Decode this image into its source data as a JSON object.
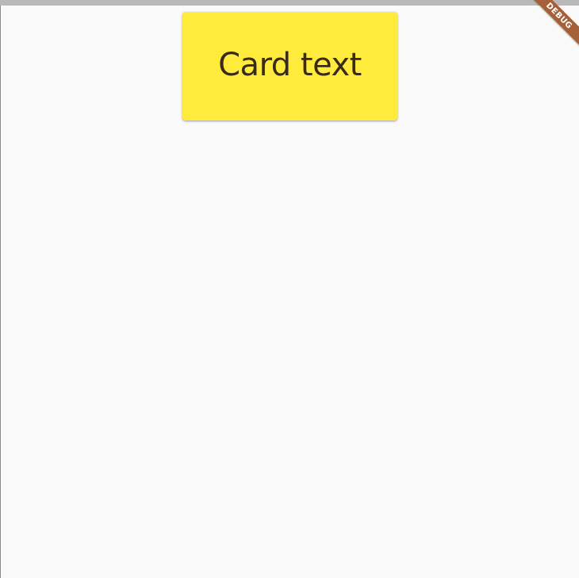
{
  "card": {
    "text": "Card text",
    "color": "#ffeb3b"
  },
  "debug_banner": {
    "label": "DEBUG",
    "color": "#a5603a"
  }
}
